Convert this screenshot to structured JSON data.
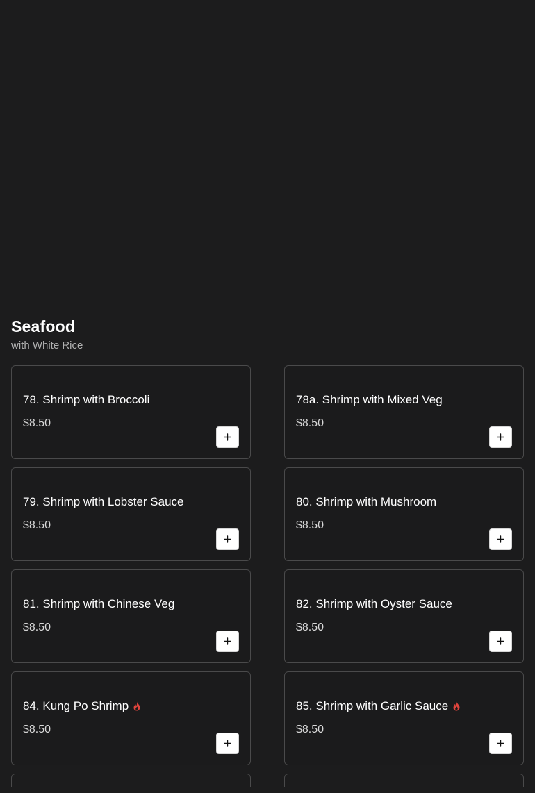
{
  "section": {
    "title": "Seafood",
    "subtitle": "with White Rice"
  },
  "items": [
    {
      "name": "78. Shrimp with Broccoli",
      "price": "$8.50",
      "spicy": false
    },
    {
      "name": "78a. Shrimp with Mixed Veg",
      "price": "$8.50",
      "spicy": false
    },
    {
      "name": "79. Shrimp with Lobster Sauce",
      "price": "$8.50",
      "spicy": false
    },
    {
      "name": "80. Shrimp with Mushroom",
      "price": "$8.50",
      "spicy": false
    },
    {
      "name": "81. Shrimp with Chinese Veg",
      "price": "$8.50",
      "spicy": false
    },
    {
      "name": "82. Shrimp with Oyster Sauce",
      "price": "$8.50",
      "spicy": false
    },
    {
      "name": "84. Kung Po Shrimp",
      "price": "$8.50",
      "spicy": true
    },
    {
      "name": "85. Shrimp with Garlic Sauce",
      "price": "$8.50",
      "spicy": true
    }
  ],
  "icons": {
    "add": "plus-icon",
    "spicy": "flame-icon"
  },
  "colors": {
    "background": "#1c1c1d",
    "card_border": "#4a4a4b",
    "spicy": "#e0443c",
    "add_button_bg": "#ffffff"
  }
}
